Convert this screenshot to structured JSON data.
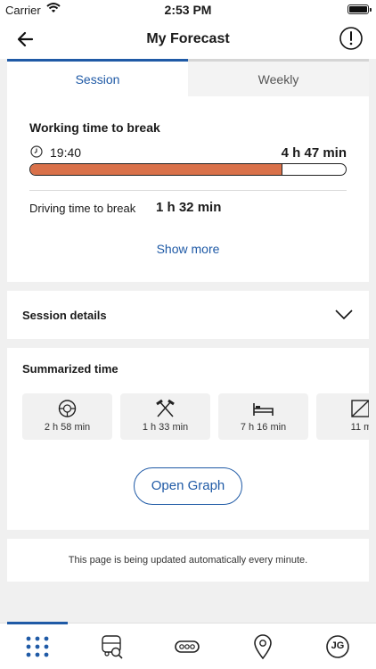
{
  "status_bar": {
    "carrier": "Carrier",
    "time": "2:53 PM"
  },
  "header": {
    "title": "My Forecast",
    "back_icon": "arrow-left-icon",
    "info_icon": "info-circle-icon"
  },
  "tabs": [
    {
      "label": "Session",
      "active": true
    },
    {
      "label": "Weekly",
      "active": false
    }
  ],
  "working": {
    "label": "Working time to break",
    "start_time": "19:40",
    "remaining": "4 h 47 min",
    "progress_fraction": 0.8,
    "bar_color": "#d9714a"
  },
  "driving": {
    "label": "Driving time to break",
    "value": "1 h 32 min"
  },
  "show_more": "Show more",
  "session_details": {
    "label": "Session details",
    "icon": "chevron-down-icon"
  },
  "summarized": {
    "label": "Summarized time",
    "items": [
      {
        "icon": "steering-wheel-icon",
        "value": "2 h 58 min"
      },
      {
        "icon": "crossed-hammers-icon",
        "value": "1 h 33 min"
      },
      {
        "icon": "bed-icon",
        "value": "7 h 16 min"
      },
      {
        "icon": "slash-square-icon",
        "value": "11 m"
      }
    ]
  },
  "open_graph": "Open Graph",
  "auto_update_note": "This page is being updated automatically every minute.",
  "accent_color": "#1f5aa6",
  "tab_bar": [
    {
      "icon": "grid-dots-icon",
      "active": true
    },
    {
      "icon": "truck-search-icon",
      "active": false
    },
    {
      "icon": "tachograph-icon",
      "active": false
    },
    {
      "icon": "location-pin-icon",
      "active": false
    },
    {
      "icon": "avatar-icon",
      "initials": "JG",
      "active": false
    }
  ]
}
